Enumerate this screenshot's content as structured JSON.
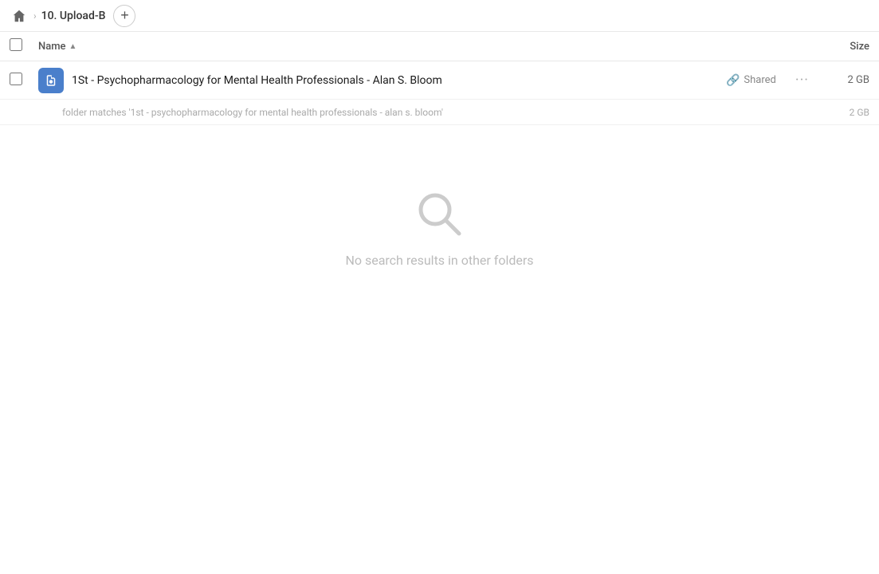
{
  "breadcrumb": {
    "home_icon": "🏠",
    "separator": "›",
    "current_folder": "10. Upload-B",
    "add_button_label": "+"
  },
  "column_headers": {
    "name_label": "Name",
    "sort_indicator": "▲",
    "size_label": "Size"
  },
  "file_row": {
    "file_name": "1St - Psychopharmacology for Mental Health Professionals - Alan S. Bloom",
    "shared_label": "Shared",
    "more_label": "···",
    "file_size": "2 GB"
  },
  "folder_match": {
    "text": "folder matches '1st - psychopharmacology for mental health professionals - alan s. bloom'",
    "size": "2 GB"
  },
  "empty_state": {
    "message": "No search results in other folders"
  }
}
